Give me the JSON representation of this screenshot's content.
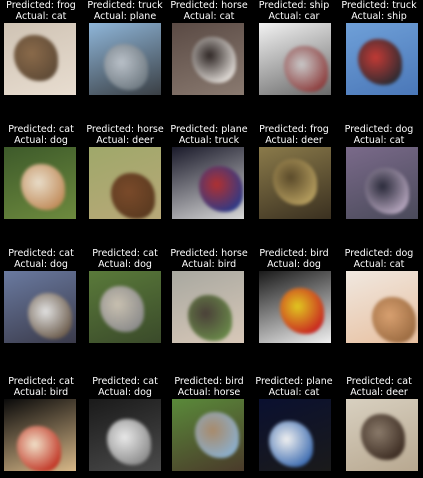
{
  "figure": {
    "rows": [
      [
        {
          "pred_text": "Predicted: frog",
          "actual_text": "Actual: cat",
          "palette": [
            "#cfc3b4",
            "#8a6a4a",
            "#5e4a36",
            "#e8ddd0"
          ]
        },
        {
          "pred_text": "Predicted: truck",
          "actual_text": "Actual: plane",
          "palette": [
            "#8fb6d9",
            "#b9c0c8",
            "#6f7a82",
            "#3a3f44"
          ]
        },
        {
          "pred_text": "Predicted: horse",
          "actual_text": "Actual: cat",
          "palette": [
            "#5a4a44",
            "#2e2624",
            "#e6e1dc",
            "#8a7a70"
          ]
        },
        {
          "pred_text": "Predicted: ship",
          "actual_text": "Actual: car",
          "palette": [
            "#f2f2f2",
            "#c8c8c8",
            "#8c3a3a",
            "#6a6a6a"
          ]
        },
        {
          "pred_text": "Predicted: truck",
          "actual_text": "Actual: ship",
          "palette": [
            "#6fa0d8",
            "#c23a35",
            "#2a2a30",
            "#4a77b8"
          ]
        }
      ],
      [
        {
          "pred_text": "Predicted: cat",
          "actual_text": "Actual: dog",
          "palette": [
            "#3d5a2a",
            "#e8dcc8",
            "#c08a58",
            "#6d8a3e"
          ]
        },
        {
          "pred_text": "Predicted: horse",
          "actual_text": "Actual: deer",
          "palette": [
            "#9fa86a",
            "#7a4a2a",
            "#5a3a20",
            "#b8a878"
          ]
        },
        {
          "pred_text": "Predicted: plane",
          "actual_text": "Actual: truck",
          "palette": [
            "#1a1a2a",
            "#b03030",
            "#2a3a8a",
            "#d8d8d8"
          ]
        },
        {
          "pred_text": "Predicted: frog",
          "actual_text": "Actual: deer",
          "palette": [
            "#8a7a4a",
            "#5a4a2a",
            "#b8a060",
            "#3a3020"
          ]
        },
        {
          "pred_text": "Predicted: dog",
          "actual_text": "Actual: cat",
          "palette": [
            "#7a6a8a",
            "#2a2a3a",
            "#b8a8c0",
            "#4a4a5a"
          ]
        }
      ],
      [
        {
          "pred_text": "Predicted: cat",
          "actual_text": "Actual: dog",
          "palette": [
            "#6a7aa0",
            "#e0e0e0",
            "#6a5a4a",
            "#3a3a4a"
          ]
        },
        {
          "pred_text": "Predicted: cat",
          "actual_text": "Actual: dog",
          "palette": [
            "#5a7a3a",
            "#c8c0b0",
            "#8a8a8a",
            "#3a4a2a"
          ]
        },
        {
          "pred_text": "Predicted: horse",
          "actual_text": "Actual: bird",
          "palette": [
            "#a8a8a0",
            "#4a4038",
            "#6a8a4a",
            "#d8c8b8"
          ]
        },
        {
          "pred_text": "Predicted: bird",
          "actual_text": "Actual: dog",
          "palette": [
            "#1a1a1a",
            "#e0c820",
            "#c82020",
            "#f0f0f0"
          ]
        },
        {
          "pred_text": "Predicted: dog",
          "actual_text": "Actual: cat",
          "palette": [
            "#f0e8e0",
            "#d8a070",
            "#9a6a40",
            "#e8c0a0"
          ]
        }
      ],
      [
        {
          "pred_text": "Predicted: cat",
          "actual_text": "Actual: bird",
          "palette": [
            "#0a0a0a",
            "#f0e0c8",
            "#c03020",
            "#d8b888"
          ]
        },
        {
          "pred_text": "Predicted: cat",
          "actual_text": "Actual: dog",
          "palette": [
            "#1a1a1a",
            "#e8e8e8",
            "#8a8a8a",
            "#4a4a4a"
          ]
        },
        {
          "pred_text": "Predicted: bird",
          "actual_text": "Actual: horse",
          "palette": [
            "#5a8a3a",
            "#a88a6a",
            "#8ab0d0",
            "#4a3a2a"
          ]
        },
        {
          "pred_text": "Predicted: plane",
          "actual_text": "Actual: cat",
          "palette": [
            "#0a1030",
            "#f0f0f0",
            "#3a6ab0",
            "#1a1a1a"
          ]
        },
        {
          "pred_text": "Predicted: cat",
          "actual_text": "Actual: deer",
          "palette": [
            "#d8d0c0",
            "#8a7a6a",
            "#3a2a20",
            "#b8a890"
          ]
        }
      ]
    ]
  }
}
